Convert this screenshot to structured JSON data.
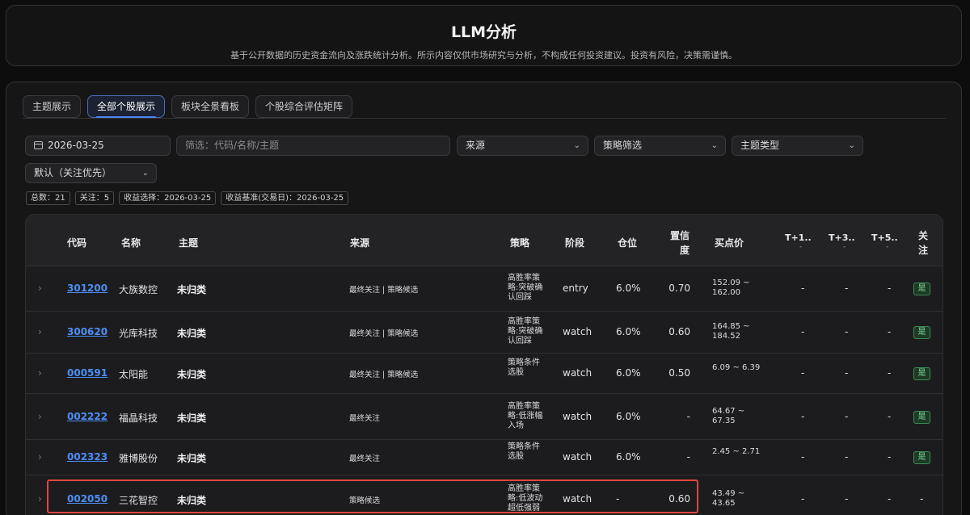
{
  "header": {
    "title": "LLM分析",
    "subtitle": "基于公开数据的历史资金流向及涨跌统计分析。所示内容仅供市场研究与分析，不构成任何投资建议。投资有风险，决策需谨慎。"
  },
  "tabs": [
    {
      "label": "主题展示",
      "active": false
    },
    {
      "label": "全部个股展示",
      "active": true
    },
    {
      "label": "板块全景看板",
      "active": false
    },
    {
      "label": "个股综合评估矩阵",
      "active": false
    }
  ],
  "filters": {
    "date": "2026-03-25",
    "search_placeholder": "筛选：代码/名称/主题",
    "source": "来源",
    "strategy": "策略筛选",
    "theme_type": "主题类型",
    "sort": "默认（关注优先）"
  },
  "stats": [
    "总数：21",
    "关注：5",
    "收益选择：2026-03-25",
    "收益基准(交易日)：2026-03-25"
  ],
  "columns": {
    "code": "代码",
    "name": "名称",
    "theme": "主题",
    "source": "来源",
    "strategy": "策略",
    "stage": "阶段",
    "position": "仓位",
    "confidence_1": "置信",
    "confidence_2": "度",
    "buy_price": "买点价",
    "t1": "T+1..",
    "t3": "T+3..",
    "t5": "T+5..",
    "follow_1": "关",
    "follow_2": "注",
    "dash": "-"
  },
  "rows": [
    {
      "code": "301200",
      "name": "大族数控",
      "theme": "未归类",
      "source": "最终关注 | 策略候选",
      "strategy": "高胜率策略:突破确认回踩",
      "stage": "entry",
      "position": "6.0%",
      "confidence": "0.70",
      "buy_price": "152.09 ~ 162.00",
      "t1": "-",
      "t3": "-",
      "t5": "-",
      "follow": "是"
    },
    {
      "code": "300620",
      "name": "光库科技",
      "theme": "未归类",
      "source": "最终关注 | 策略候选",
      "strategy": "高胜率策略:突破确认回踩",
      "stage": "watch",
      "position": "6.0%",
      "confidence": "0.60",
      "buy_price": "164.85 ~ 184.52",
      "t1": "-",
      "t3": "-",
      "t5": "-",
      "follow": "是"
    },
    {
      "code": "000591",
      "name": "太阳能",
      "theme": "未归类",
      "source": "最终关注 | 策略候选",
      "strategy": "策略条件选股",
      "stage": "watch",
      "position": "6.0%",
      "confidence": "0.50",
      "buy_price": "6.09 ~ 6.39",
      "t1": "-",
      "t3": "-",
      "t5": "-",
      "follow": "是"
    },
    {
      "code": "002222",
      "name": "福晶科技",
      "theme": "未归类",
      "source": "最终关注",
      "strategy": "高胜率策略:低涨幅入场",
      "stage": "watch",
      "position": "6.0%",
      "confidence": "-",
      "buy_price": "64.67 ~ 67.35",
      "t1": "-",
      "t3": "-",
      "t5": "-",
      "follow": "是"
    },
    {
      "code": "002323",
      "name": "雅博股份",
      "theme": "未归类",
      "source": "最终关注",
      "strategy": "策略条件选股",
      "stage": "watch",
      "position": "6.0%",
      "confidence": "-",
      "buy_price": "2.45 ~ 2.71",
      "t1": "-",
      "t3": "-",
      "t5": "-",
      "follow": "是"
    },
    {
      "code": "002050",
      "name": "三花智控",
      "theme": "未归类",
      "source": "策略候选",
      "strategy": "高胜率策略:低波动超低强弱",
      "stage": "watch",
      "position": "-",
      "confidence": "0.60",
      "buy_price": "43.49 ~ 43.65",
      "t1": "-",
      "t3": "-",
      "t5": "-",
      "follow": "-"
    }
  ]
}
